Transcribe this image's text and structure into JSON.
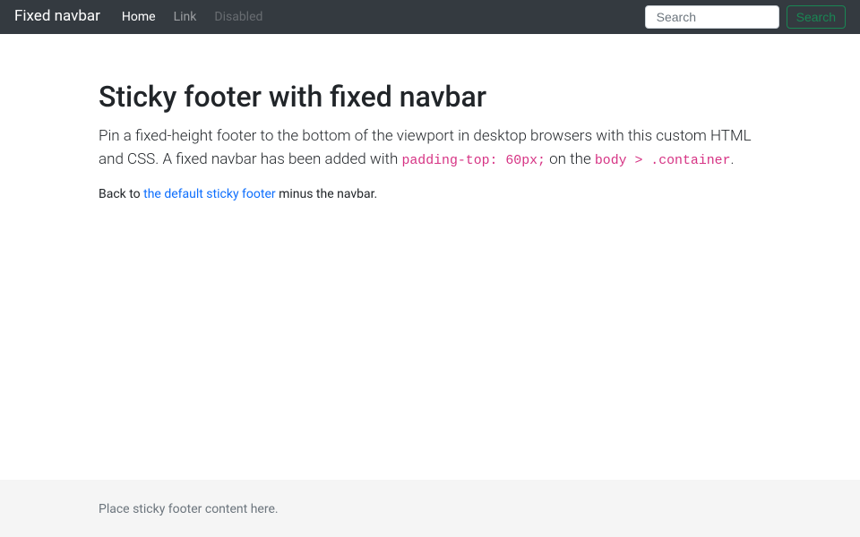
{
  "navbar": {
    "brand": "Fixed navbar",
    "items": [
      {
        "label": "Home",
        "state": "active"
      },
      {
        "label": "Link",
        "state": "normal"
      },
      {
        "label": "Disabled",
        "state": "disabled"
      }
    ],
    "search": {
      "placeholder": "Search",
      "button_label": "Search"
    }
  },
  "main": {
    "heading": "Sticky footer with fixed navbar",
    "lead_part1": "Pin a fixed-height footer to the bottom of the viewport in desktop browsers with this custom HTML and CSS. A fixed navbar has been added with ",
    "lead_code1": "padding-top: 60px;",
    "lead_part2": " on the ",
    "lead_code2": "body > .container",
    "lead_part3": ".",
    "back_part1": "Back to ",
    "back_link": "the default sticky footer",
    "back_part2": " minus the navbar."
  },
  "footer": {
    "text": "Place sticky footer content here."
  }
}
